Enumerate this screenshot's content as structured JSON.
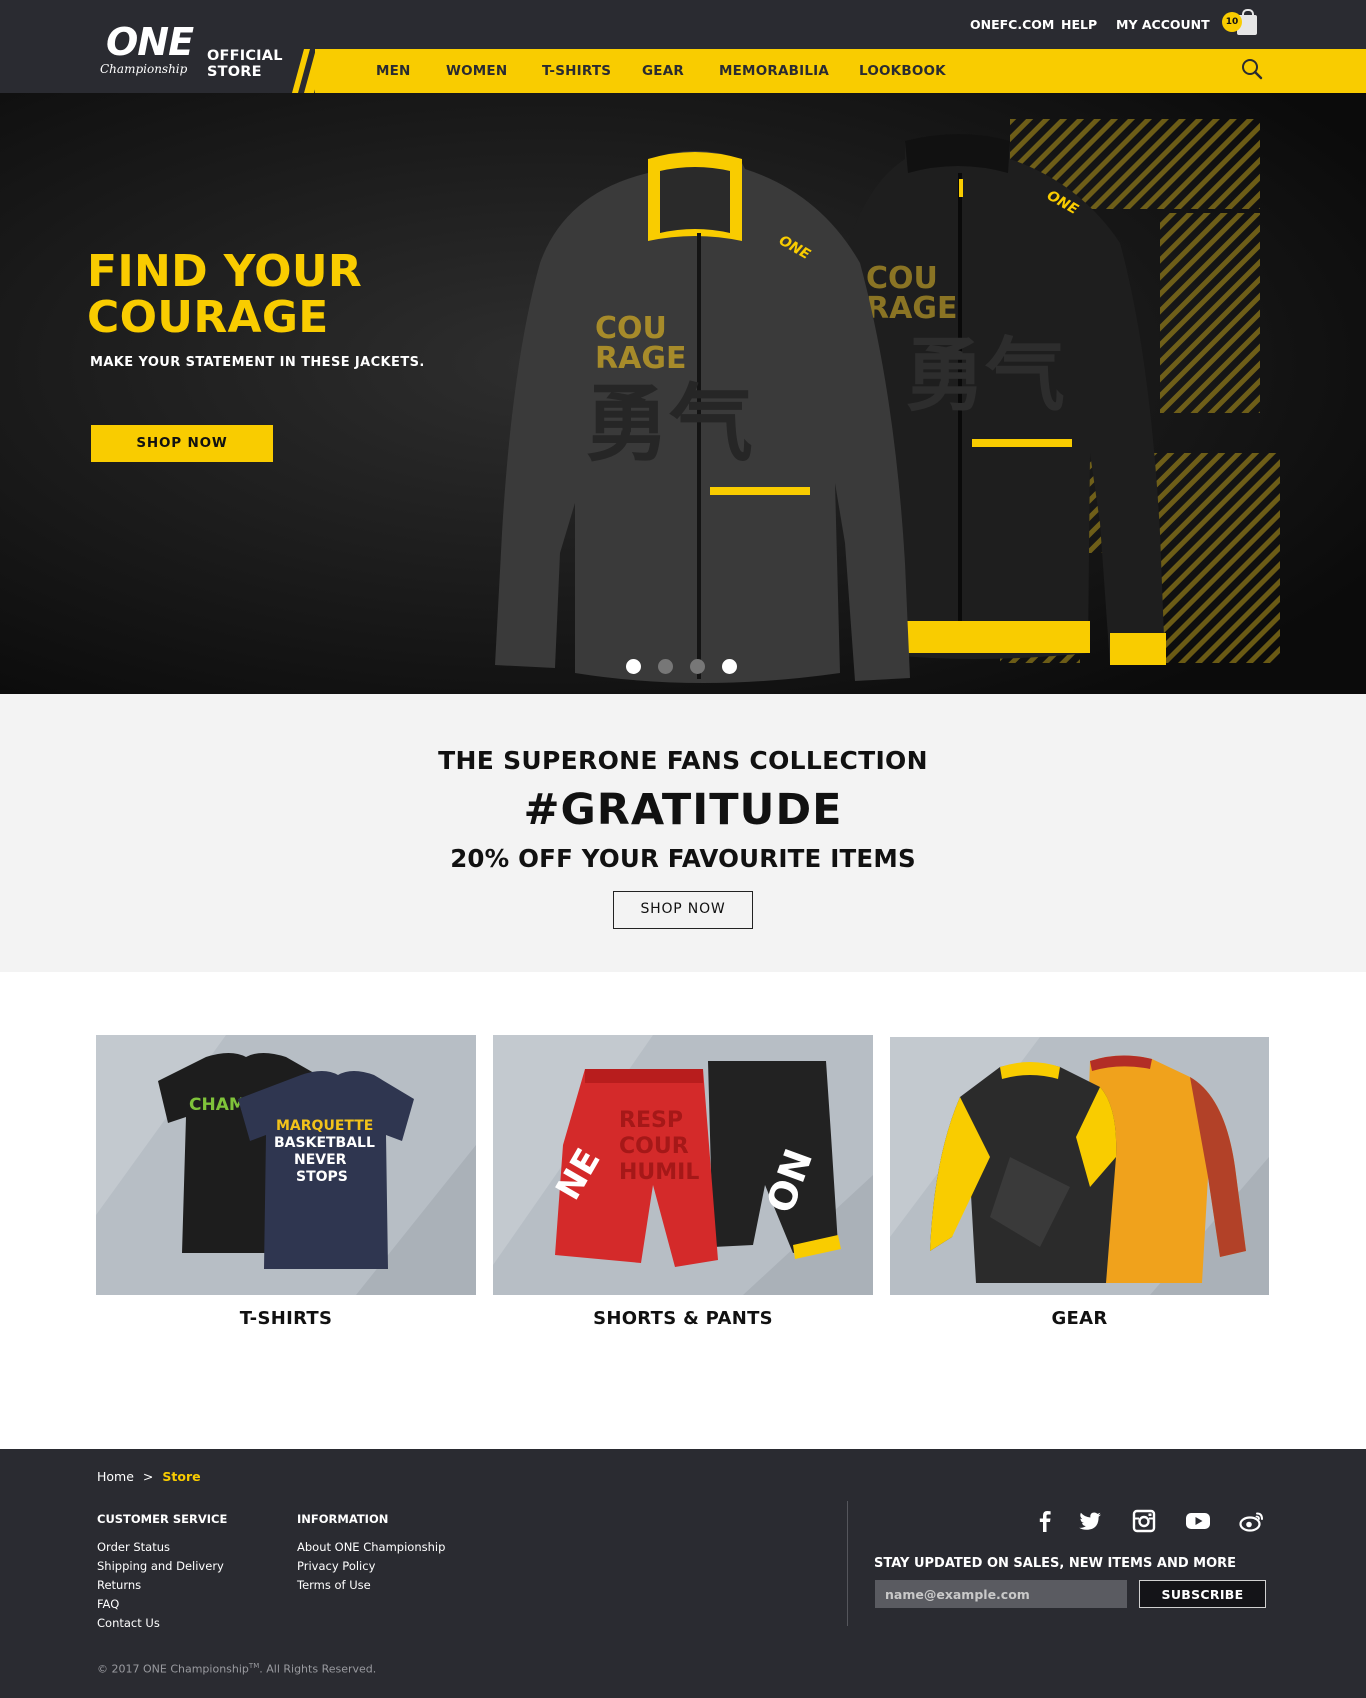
{
  "header": {
    "logo_word": "ONE",
    "logo_sub": "Championship",
    "store_line1": "OFFICIAL",
    "store_line2": "STORE",
    "top_links": [
      "ONEFC.COM",
      "HELP",
      "MY ACCOUNT"
    ],
    "cart_count": "10",
    "nav": [
      "MEN",
      "WOMEN",
      "T-SHIRTS",
      "GEAR",
      "MEMORABILIA",
      "LOOKBOOK"
    ],
    "accent": "#f9cc00",
    "bar_color": "#2a2b31"
  },
  "hero": {
    "title_line1": "FIND YOUR",
    "title_line2": "COURAGE",
    "subtitle": "MAKE YOUR STATEMENT IN THESE JACKETS.",
    "button": "SHOP NOW",
    "slide_count": 4,
    "active_slide": 1
  },
  "promo": {
    "line1": "THE SUPERONE FANS COLLECTION",
    "line2": "#GRATITUDE",
    "line3": "20% OFF YOUR FAVOURITE ITEMS",
    "button": "SHOP NOW"
  },
  "categories": [
    {
      "label": "T-SHIRTS",
      "icon": "tshirts-image"
    },
    {
      "label": "SHORTS & PANTS",
      "icon": "shorts-image"
    },
    {
      "label": "GEAR",
      "icon": "rashguard-image"
    }
  ],
  "footer": {
    "breadcrumb": {
      "home": "Home",
      "sep": ">",
      "current": "Store"
    },
    "customer_service": {
      "title": "CUSTOMER SERVICE",
      "links": [
        "Order Status",
        "Shipping and Delivery",
        "Returns",
        "FAQ",
        "Contact Us"
      ]
    },
    "information": {
      "title": "INFORMATION",
      "links": [
        "About ONE Championship",
        "Privacy Policy",
        "Terms of Use"
      ]
    },
    "social": [
      "facebook-icon",
      "twitter-icon",
      "instagram-icon",
      "youtube-icon",
      "weibo-icon"
    ],
    "newsletter_title": "STAY UPDATED ON SALES, NEW ITEMS AND MORE",
    "email_placeholder": "name@example.com",
    "subscribe": "SUBSCRIBE",
    "copyright_pre": "© 2017 ONE Championship",
    "copyright_tm": "TM",
    "copyright_post": ". All Rights Reserved."
  }
}
